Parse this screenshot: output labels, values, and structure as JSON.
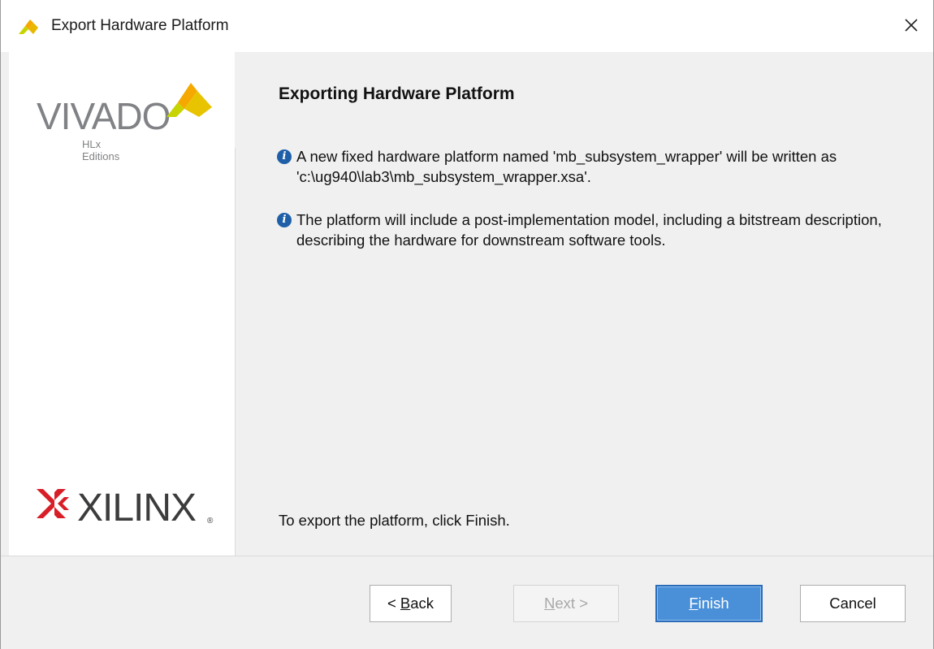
{
  "window": {
    "title": "Export Hardware Platform",
    "close_glyph": "✕"
  },
  "sidebar": {
    "vivado_logo_text": "VIVADO",
    "vivado_sub_text": "HLx Editions",
    "xilinx_logo_text": "XILINX",
    "xilinx_reg_mark": "®"
  },
  "main": {
    "title": "Exporting Hardware Platform",
    "info_items": [
      {
        "icon": "info-icon",
        "text": "A new fixed hardware platform named 'mb_subsystem_wrapper' will be written as 'c:\\ug940\\lab3\\mb_subsystem_wrapper.xsa'."
      },
      {
        "icon": "info-icon",
        "text": "The platform will include a post-implementation model, including a bitstream description, describing the hardware for downstream software tools."
      }
    ],
    "footer": "To export the platform, click Finish."
  },
  "buttons": {
    "back": {
      "prefix": "< ",
      "mnemonic": "B",
      "rest": "ack"
    },
    "next": {
      "mnemonic": "N",
      "rest": "ext >"
    },
    "finish": {
      "mnemonic": "F",
      "rest": "inish"
    },
    "cancel": "Cancel"
  },
  "colors": {
    "accent": "#4a90d9",
    "info_icon": "#1f5fa8",
    "vivado_yellow": "#c8d400",
    "xilinx_red": "#d81e27"
  }
}
